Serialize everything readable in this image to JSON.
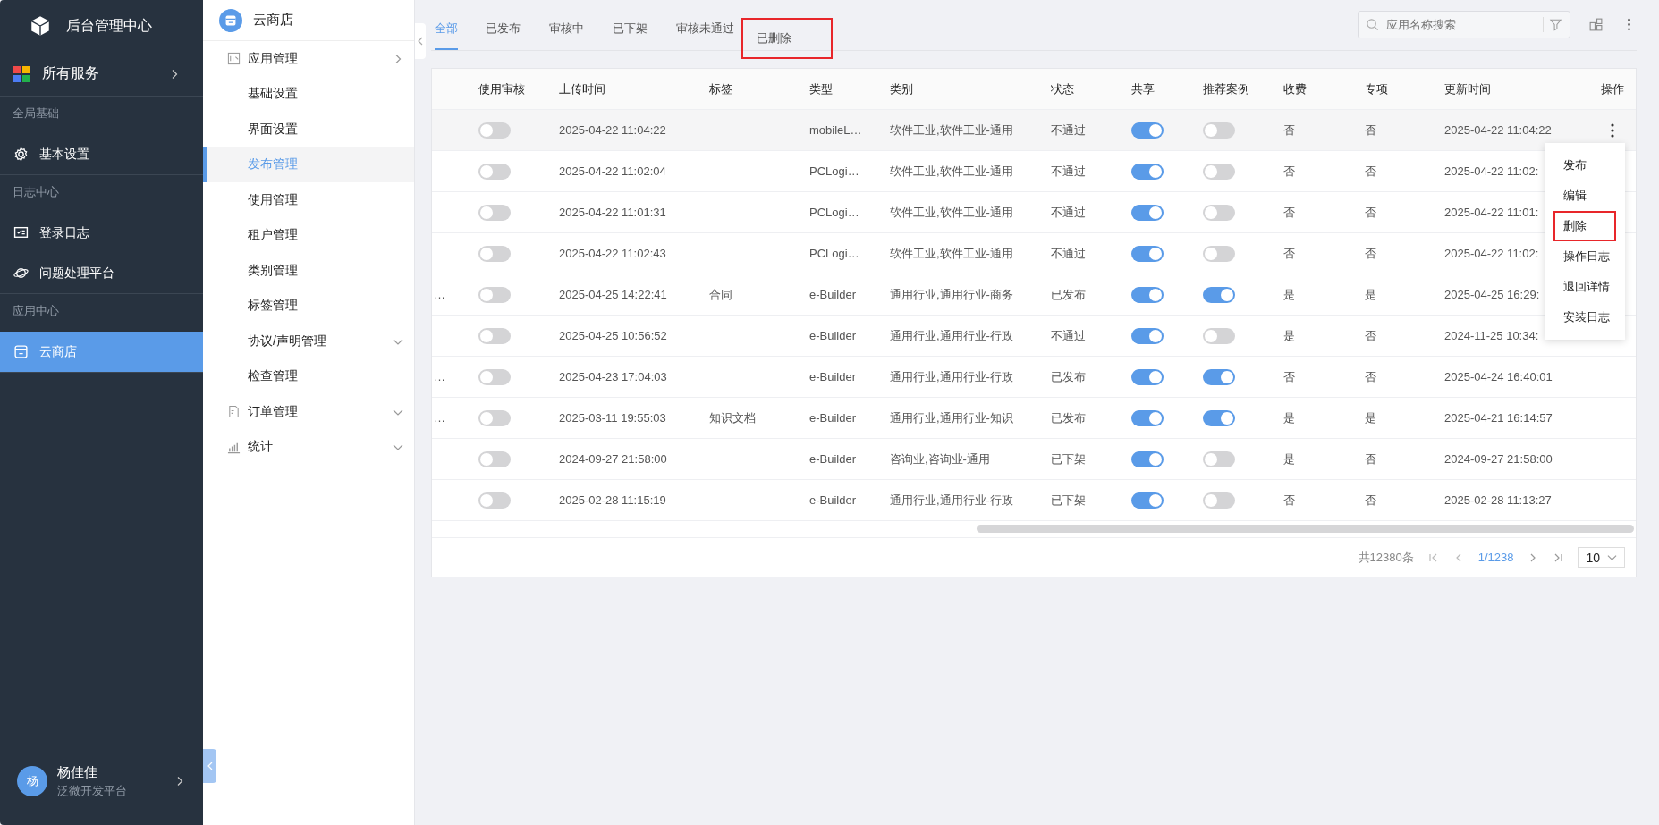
{
  "brand": {
    "title": "后台管理中心"
  },
  "all_services": {
    "label": "所有服务"
  },
  "nav_sections": [
    {
      "title": "全局基础",
      "items": [
        {
          "label": "基本设置",
          "selected": false
        }
      ]
    },
    {
      "title": "日志中心",
      "items": [
        {
          "label": "登录日志",
          "selected": false
        },
        {
          "label": "问题处理平台",
          "selected": false
        }
      ]
    },
    {
      "title": "应用中心",
      "items": [
        {
          "label": "云商店",
          "selected": true
        }
      ]
    }
  ],
  "user": {
    "avatar": "杨",
    "name": "杨佳佳",
    "org": "泛微开发平台"
  },
  "submenu": {
    "title": "云商店",
    "items": [
      {
        "label": "应用管理",
        "expanded": true,
        "selected": false,
        "children": [
          {
            "label": "基础设置",
            "selected": false
          },
          {
            "label": "界面设置",
            "selected": false
          },
          {
            "label": "发布管理",
            "selected": true
          },
          {
            "label": "使用管理",
            "selected": false
          },
          {
            "label": "租户管理",
            "selected": false
          },
          {
            "label": "类别管理",
            "selected": false
          },
          {
            "label": "标签管理",
            "selected": false
          },
          {
            "label": "协议/声明管理",
            "expanded": false,
            "selected": false
          },
          {
            "label": "检查管理",
            "selected": false
          }
        ]
      },
      {
        "label": "订单管理",
        "expanded": false,
        "selected": false
      },
      {
        "label": "统计",
        "expanded": false,
        "selected": false
      }
    ]
  },
  "tabs": [
    {
      "label": "全部",
      "selected": true,
      "highlighted": false
    },
    {
      "label": "已发布",
      "selected": false,
      "highlighted": false
    },
    {
      "label": "审核中",
      "selected": false,
      "highlighted": false
    },
    {
      "label": "已下架",
      "selected": false,
      "highlighted": false
    },
    {
      "label": "审核未通过",
      "selected": false,
      "highlighted": false
    },
    {
      "label": "已删除",
      "selected": false,
      "highlighted": true
    }
  ],
  "search": {
    "placeholder": "应用名称搜索"
  },
  "table": {
    "columns": [
      "使用审核",
      "上传时间",
      "标签",
      "类型",
      "类别",
      "状态",
      "共享",
      "推荐案例",
      "收费",
      "专项",
      "更新时间",
      "操作"
    ],
    "rows": [
      {
        "review": false,
        "upload_time": "2025-04-22 11:04:22",
        "type": "mobileL…",
        "category": "软件工业,软件工业-通用",
        "status": "不通过",
        "shared": true,
        "recommended": false,
        "paid": "否",
        "special": "否",
        "update_time": "2025-04-22 11:04:22",
        "highlighted": true
      },
      {
        "review": false,
        "upload_time": "2025-04-22 11:02:04",
        "type": "PCLogi…",
        "category": "软件工业,软件工业-通用",
        "status": "不通过",
        "shared": true,
        "recommended": false,
        "paid": "否",
        "special": "否",
        "update_time": "2025-04-22 11:02:",
        "highlighted": false
      },
      {
        "review": false,
        "upload_time": "2025-04-22 11:01:31",
        "type": "PCLogi…",
        "category": "软件工业,软件工业-通用",
        "status": "不通过",
        "shared": true,
        "recommended": false,
        "paid": "否",
        "special": "否",
        "update_time": "2025-04-22 11:01:",
        "highlighted": false
      },
      {
        "review": false,
        "upload_time": "2025-04-22 11:02:43",
        "type": "PCLogi…",
        "category": "软件工业,软件工业-通用",
        "status": "不通过",
        "shared": true,
        "recommended": false,
        "paid": "否",
        "special": "否",
        "update_time": "2025-04-22 11:02:",
        "highlighted": false
      },
      {
        "column_1": "…",
        "review": false,
        "upload_time": "2025-04-25 14:22:41",
        "tag": "合同",
        "type": "e-Builder",
        "category": "通用行业,通用行业-商务",
        "status": "已发布",
        "shared": true,
        "recommended": true,
        "paid": "是",
        "special": "是",
        "update_time": "2025-04-25 16:29:",
        "highlighted": false
      },
      {
        "review": false,
        "upload_time": "2025-04-25 10:56:52",
        "type": "e-Builder",
        "category": "通用行业,通用行业-行政",
        "status": "不通过",
        "shared": true,
        "recommended": false,
        "paid": "是",
        "special": "否",
        "update_time": "2024-11-25 10:34:",
        "highlighted": false
      },
      {
        "column_1": "…",
        "review": false,
        "upload_time": "2025-04-23 17:04:03",
        "type": "e-Builder",
        "category": "通用行业,通用行业-行政",
        "status": "已发布",
        "shared": true,
        "recommended": true,
        "paid": "否",
        "special": "否",
        "update_time": "2025-04-24 16:40:01",
        "highlighted": false
      },
      {
        "column_1": "…",
        "review": false,
        "upload_time": "2025-03-11 19:55:03",
        "tag": "知识文档",
        "type": "e-Builder",
        "category": "通用行业,通用行业-知识",
        "status": "已发布",
        "shared": true,
        "recommended": true,
        "paid": "是",
        "special": "是",
        "update_time": "2025-04-21 16:14:57",
        "highlighted": false
      },
      {
        "review": false,
        "upload_time": "2024-09-27 21:58:00",
        "type": "e-Builder",
        "category": "咨询业,咨询业-通用",
        "status": "已下架",
        "shared": true,
        "recommended": false,
        "paid": "是",
        "special": "否",
        "update_time": "2024-09-27 21:58:00",
        "highlighted": false
      },
      {
        "review": false,
        "upload_time": "2025-02-28 11:15:19",
        "type": "e-Builder",
        "category": "通用行业,通用行业-行政",
        "status": "已下架",
        "shared": true,
        "recommended": false,
        "paid": "否",
        "special": "否",
        "update_time": "2025-02-28 11:13:27",
        "highlighted": false
      }
    ]
  },
  "action_menu": {
    "items": [
      {
        "label": "发布",
        "highlighted": false
      },
      {
        "label": "编辑",
        "highlighted": false
      },
      {
        "label": "删除",
        "highlighted": true
      },
      {
        "label": "操作日志",
        "highlighted": false
      },
      {
        "label": "退回详情",
        "highlighted": false
      },
      {
        "label": "安装日志",
        "highlighted": false
      }
    ]
  },
  "pagination": {
    "total": "共12380条",
    "page": "1/1238",
    "page_size": "10"
  }
}
